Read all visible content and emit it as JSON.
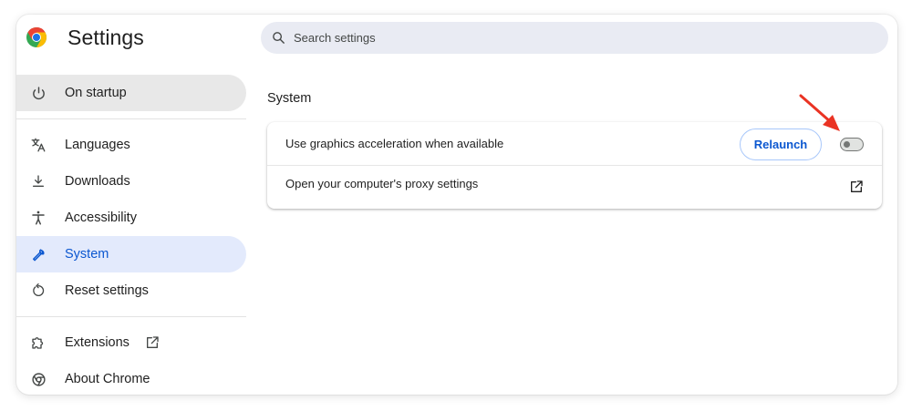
{
  "app": {
    "title": "Settings"
  },
  "search": {
    "placeholder": "Search settings"
  },
  "sidebar": {
    "items": [
      {
        "label": "On startup",
        "icon": "power-icon",
        "state": "hover"
      },
      {
        "label": "Languages",
        "icon": "translate-icon"
      },
      {
        "label": "Downloads",
        "icon": "download-icon"
      },
      {
        "label": "Accessibility",
        "icon": "accessibility-icon"
      },
      {
        "label": "System",
        "icon": "wrench-icon",
        "state": "selected"
      },
      {
        "label": "Reset settings",
        "icon": "reset-icon"
      },
      {
        "label": "Extensions",
        "icon": "puzzle-icon",
        "external_icon": "open-in-new-icon"
      },
      {
        "label": "About Chrome",
        "icon": "chrome-icon"
      }
    ]
  },
  "main": {
    "section_title": "System",
    "rows": [
      {
        "label": "Use graphics acceleration when available",
        "button": "Relaunch",
        "toggle_on": false
      },
      {
        "label": "Open your computer's proxy settings",
        "action_icon": "open-in-new-icon"
      }
    ]
  },
  "annotation": {
    "type": "arrow",
    "color": "#ea3323",
    "points_to": "graphics-acceleration-toggle"
  },
  "colors": {
    "accent": "#0b57d0",
    "selected_bg": "#e3eafc",
    "hover_bg": "#e8e8e8",
    "search_bg": "#e9ebf3"
  }
}
